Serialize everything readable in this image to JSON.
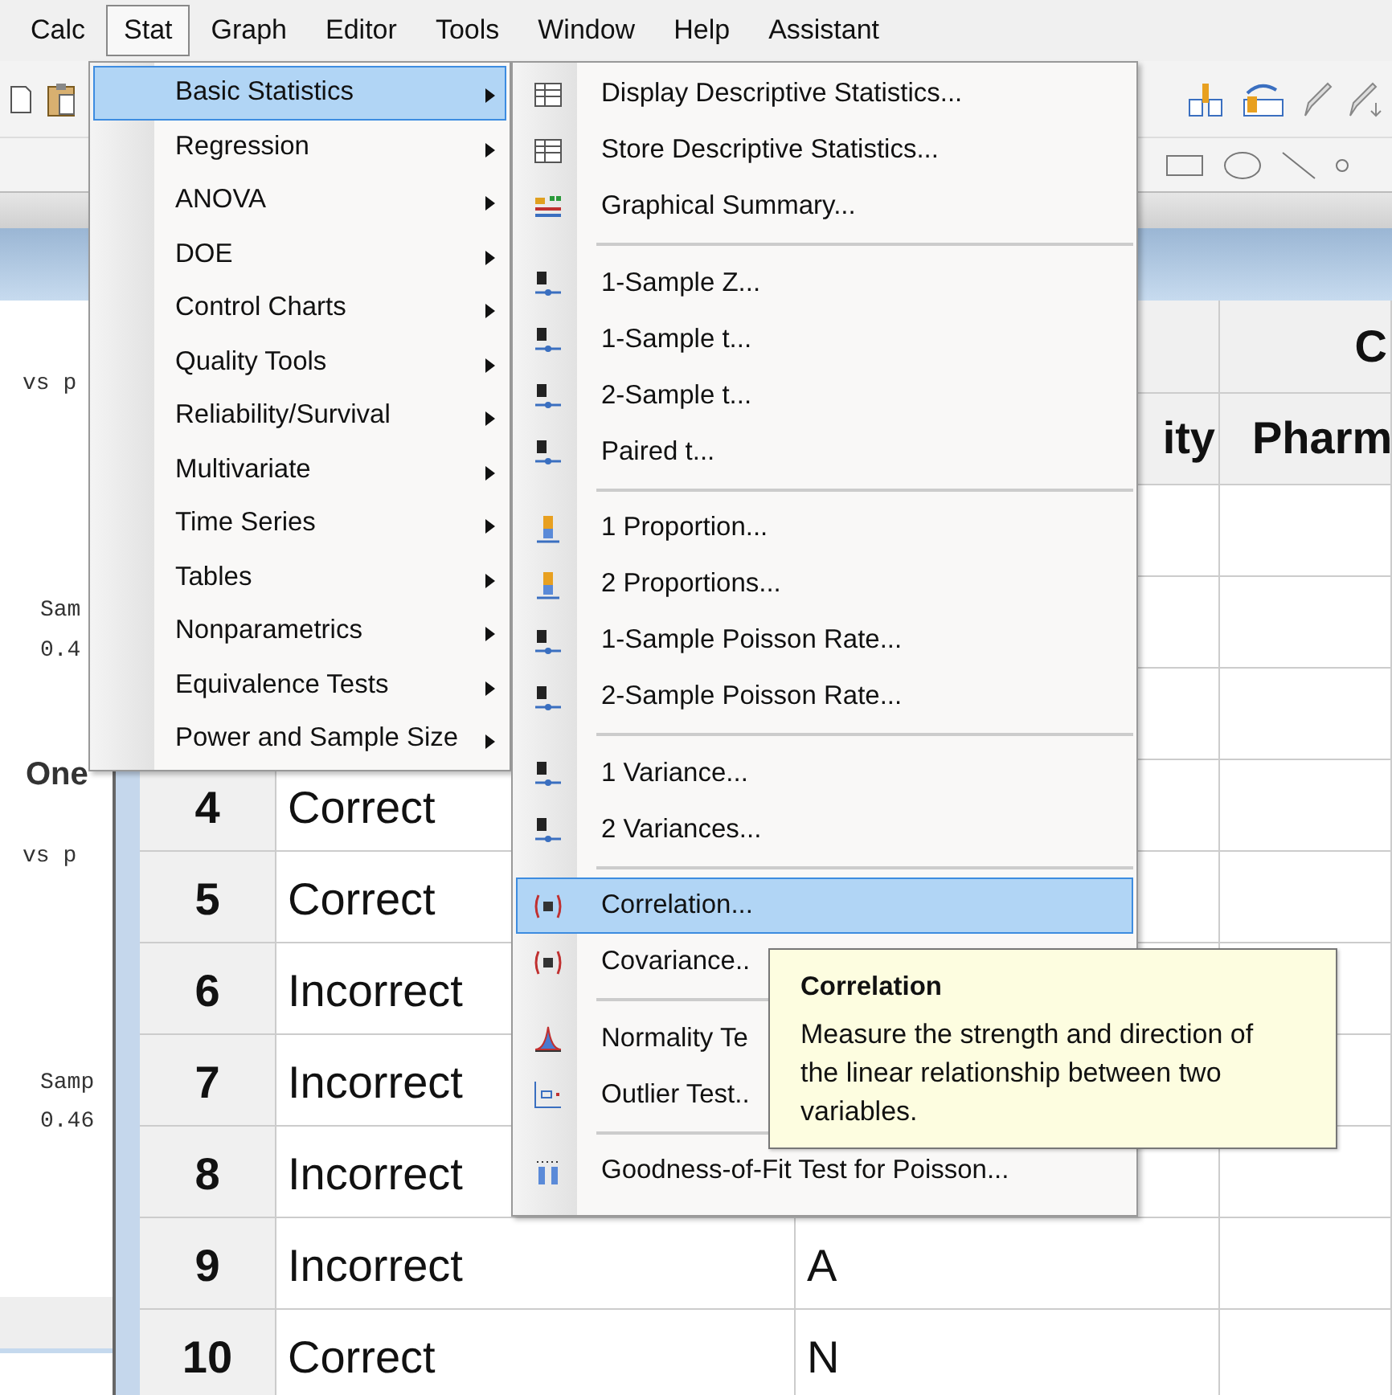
{
  "menubar": [
    {
      "label": "Calc",
      "selected": false
    },
    {
      "label": "Stat",
      "selected": true
    },
    {
      "label": "Graph",
      "selected": false
    },
    {
      "label": "Editor",
      "selected": false
    },
    {
      "label": "Tools",
      "selected": false
    },
    {
      "label": "Window",
      "selected": false
    },
    {
      "label": "Help",
      "selected": false
    },
    {
      "label": "Assistant",
      "selected": false
    }
  ],
  "session": {
    "lines": [
      {
        "text": "vs p",
        "kind": "mono"
      },
      {
        "text": "Sam",
        "kind": "mono"
      },
      {
        "text": "0.4",
        "kind": "mono"
      },
      {
        "text": "One",
        "kind": "heading"
      },
      {
        "text": "vs p",
        "kind": "mono"
      },
      {
        "text": "Samp",
        "kind": "mono"
      },
      {
        "text": "0.46",
        "kind": "mono"
      }
    ]
  },
  "worksheet": {
    "group_header": "C",
    "header": {
      "column_2": "ity",
      "column_3": "Pharm"
    },
    "rows": [
      {
        "number": "4",
        "column_1": "Correct"
      },
      {
        "number": "5",
        "column_1": "Correct"
      },
      {
        "number": "6",
        "column_1": "Incorrect"
      },
      {
        "number": "7",
        "column_1": "Incorrect"
      },
      {
        "number": "8",
        "column_1": "Incorrect"
      },
      {
        "number": "9",
        "column_1": "Incorrect",
        "column_2": "A"
      },
      {
        "number": "10",
        "column_1": "Correct",
        "column_2": "N"
      }
    ]
  },
  "stat_menu": [
    {
      "label": "Basic Statistics",
      "selected": true
    },
    {
      "label": "Regression",
      "selected": false
    },
    {
      "label": "ANOVA",
      "selected": false
    },
    {
      "label": "DOE",
      "selected": false
    },
    {
      "label": "Control Charts",
      "selected": false
    },
    {
      "label": "Quality Tools",
      "selected": false
    },
    {
      "label": "Reliability/Survival",
      "selected": false
    },
    {
      "label": "Multivariate",
      "selected": false
    },
    {
      "label": "Time Series",
      "selected": false
    },
    {
      "label": "Tables",
      "selected": false
    },
    {
      "label": "Nonparametrics",
      "selected": false
    },
    {
      "label": "Equivalence Tests",
      "selected": false
    },
    {
      "label": "Power and Sample Size",
      "selected": false
    }
  ],
  "submenu_groups": [
    [
      {
        "label": "Display Descriptive Statistics...",
        "selected": false
      },
      {
        "label": "Store Descriptive Statistics...",
        "selected": false
      },
      {
        "label": "Graphical Summary...",
        "selected": false
      }
    ],
    [
      {
        "label": "1-Sample Z...",
        "selected": false
      },
      {
        "label": "1-Sample t...",
        "selected": false
      },
      {
        "label": "2-Sample t...",
        "selected": false
      },
      {
        "label": "Paired t...",
        "selected": false
      }
    ],
    [
      {
        "label": "1 Proportion...",
        "selected": false
      },
      {
        "label": "2 Proportions...",
        "selected": false
      },
      {
        "label": "1-Sample Poisson Rate...",
        "selected": false
      },
      {
        "label": "2-Sample Poisson Rate...",
        "selected": false
      }
    ],
    [
      {
        "label": "1 Variance...",
        "selected": false
      },
      {
        "label": "2 Variances...",
        "selected": false
      }
    ],
    [
      {
        "label": "Correlation...",
        "selected": true
      },
      {
        "label": "Covariance..",
        "selected": false
      }
    ],
    [
      {
        "label": "Normality Te",
        "selected": false
      },
      {
        "label": "Outlier Test..",
        "selected": false
      }
    ],
    [
      {
        "label": "Goodness-of-Fit Test for Poisson...",
        "selected": false
      }
    ]
  ],
  "tooltip": {
    "title": "Correlation",
    "body": "Measure the strength and direction of the linear relationship between two variables."
  }
}
